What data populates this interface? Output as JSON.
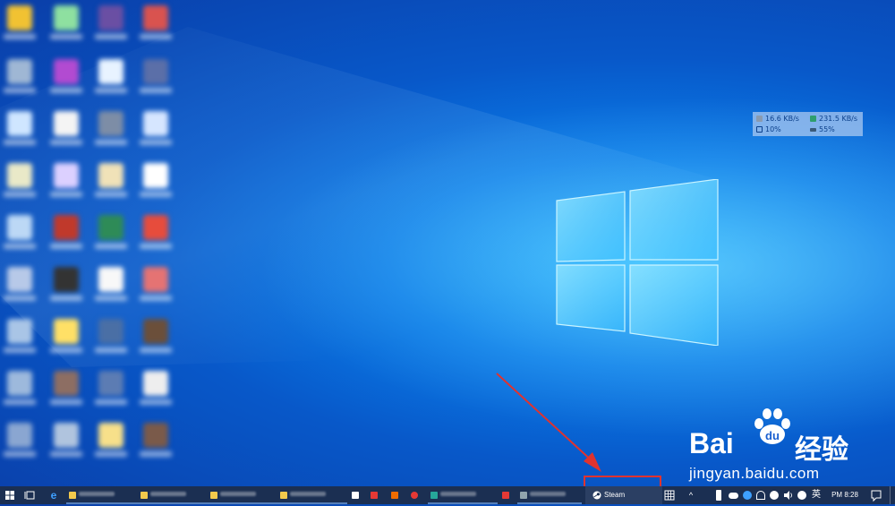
{
  "network_monitor": {
    "upload_speed": "16.6 KB/s",
    "download_speed": "231.5 KB/s",
    "cpu_usage": "10%",
    "memory_usage": "55%"
  },
  "taskbar": {
    "steam_label": "Steam",
    "ime_indicator": "英",
    "clock": "PM 8:28",
    "tray_chevron": "^"
  },
  "watermark": {
    "brand": "Bai",
    "brand_suffix": "du",
    "chinese": "经验",
    "url": "jingyan.baidu.com"
  },
  "icons": {
    "start": "windows-icon",
    "task_view": "task-view-icon",
    "browser": "edge-icon",
    "steam": "steam-icon",
    "notification": "action-center-icon"
  },
  "colors": {
    "taskbar": "#1b2f52",
    "highlight": "#e0332f",
    "arrow": "#e0332f"
  }
}
